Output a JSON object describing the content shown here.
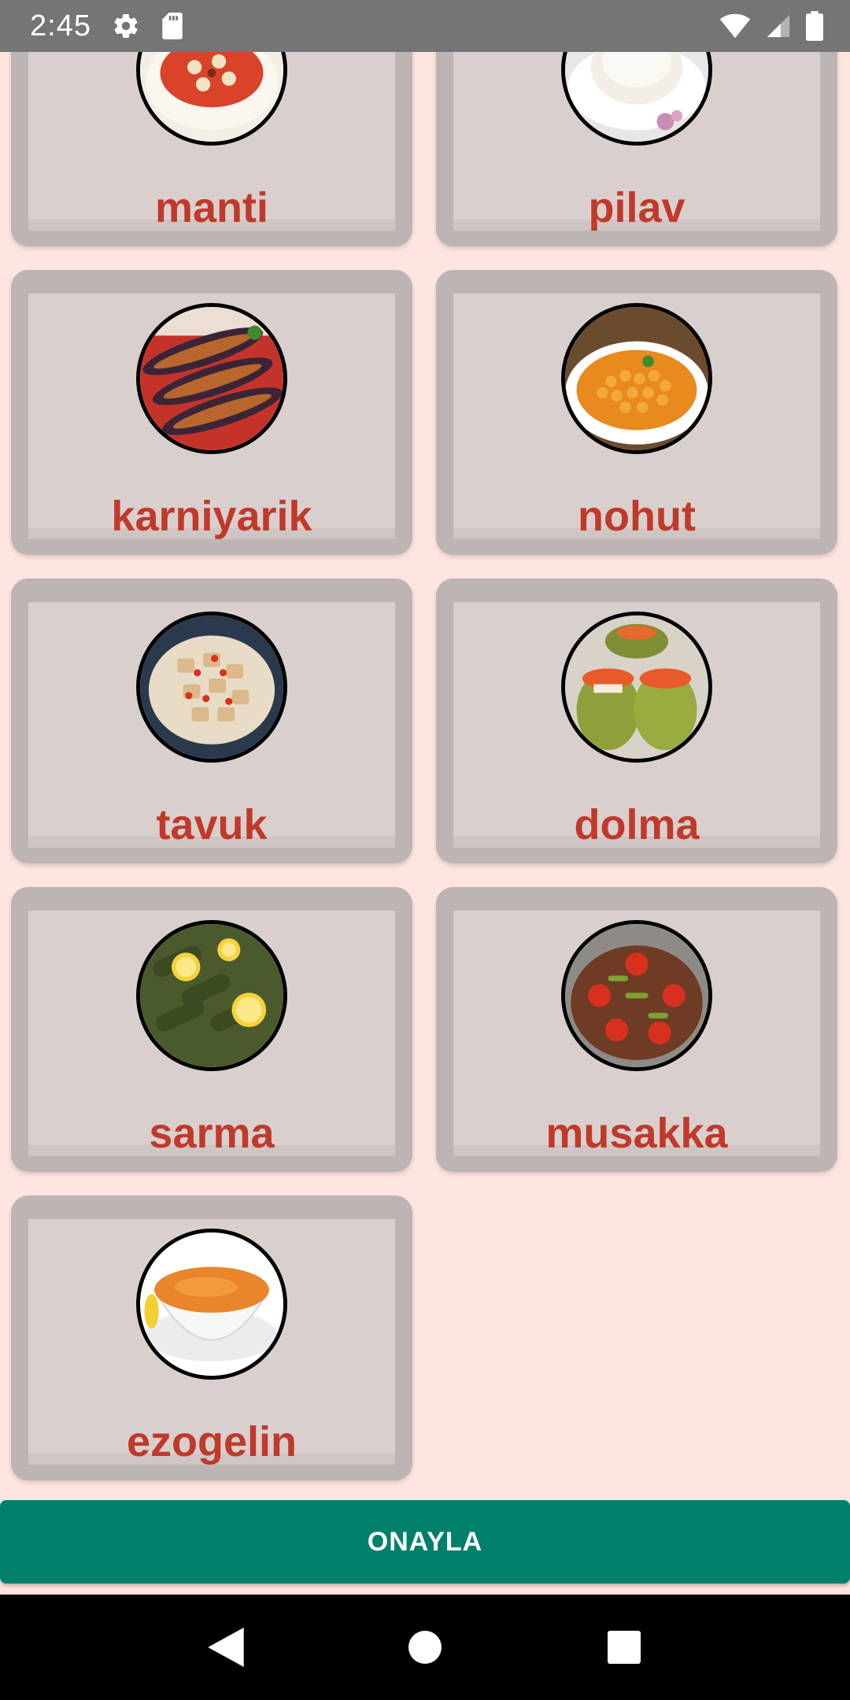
{
  "status_bar": {
    "time": "2:45",
    "left_icons": [
      "gear-icon",
      "sd-card-icon"
    ],
    "right_icons": [
      "wifi-icon",
      "signal-icon",
      "battery-icon"
    ]
  },
  "dishes": [
    {
      "name": "manti"
    },
    {
      "name": "pilav"
    },
    {
      "name": "karniyarik"
    },
    {
      "name": "nohut"
    },
    {
      "name": "tavuk"
    },
    {
      "name": "dolma"
    },
    {
      "name": "sarma"
    },
    {
      "name": "musakka"
    },
    {
      "name": "ezogelin"
    }
  ],
  "confirm_button": {
    "label": "ONAYLA"
  },
  "nav_bar": {
    "icons": [
      "back-icon",
      "home-icon",
      "recents-icon"
    ]
  },
  "colors": {
    "background": "#FFE5E1",
    "card_outer": "#BDB5B3",
    "card_inner": "#D9D0CE",
    "label": "#C0392B",
    "button": "#00806A",
    "status_bar": "#757575"
  }
}
